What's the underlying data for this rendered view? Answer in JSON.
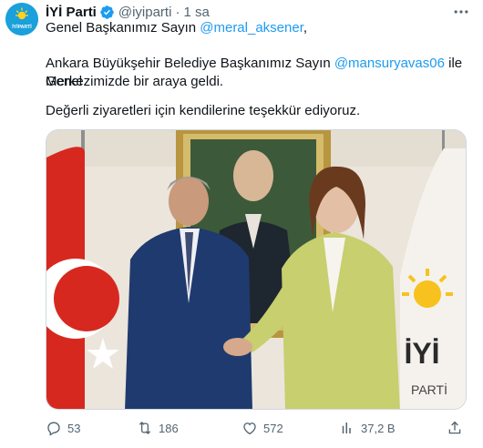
{
  "author": {
    "display_name": "İYİ Parti",
    "handle": "@iyiparti",
    "separator": "·",
    "time": "1 sa",
    "avatar_text": "İYİPARTİ"
  },
  "tweet": {
    "line1_text": "Genel Başkanımız Sayın ",
    "line1_mention": "@meral_aksener",
    "line1_end": ",",
    "line2_text": "Ankara Büyükşehir Belediye Başkanımız Sayın ",
    "line2_mention": "@mansuryavas06",
    "line2_end": " ile Genel",
    "line3_text": "Merkezimizde bir araya geldi.",
    "line4_text": "Değerli ziyaretleri için kendilerine teşekkür ediyoruz."
  },
  "media": {
    "flag_text_big": "İYİ",
    "flag_text_small": "PARTİ"
  },
  "actions": {
    "replies": "53",
    "retweets": "186",
    "likes": "572",
    "views": "37,2 B"
  },
  "colors": {
    "link": "#1d9bf0",
    "muted": "#536471",
    "verified": "#1d9bf0",
    "brand": "#1aa0db"
  }
}
